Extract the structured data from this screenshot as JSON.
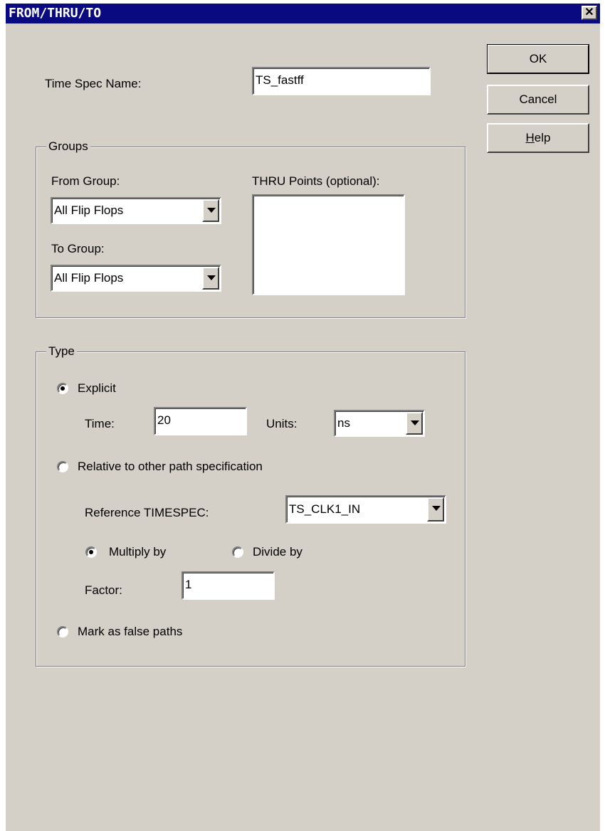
{
  "window": {
    "title": "FROM/THRU/TO",
    "close_glyph": "✕"
  },
  "buttons": {
    "ok": "OK",
    "cancel": "Cancel",
    "help_prefix": "H",
    "help_rest": "elp"
  },
  "timespec": {
    "label": "Time Spec Name:",
    "value": "TS_fastff"
  },
  "groups": {
    "legend": "Groups",
    "from_label": "From Group:",
    "from_value": "All Flip Flops",
    "to_label": "To Group:",
    "to_value": "All Flip Flops",
    "thru_label": "THRU Points (optional):"
  },
  "type": {
    "legend": "Type",
    "explicit_label": "Explicit",
    "explicit_selected": true,
    "time_label": "Time:",
    "time_value": "20",
    "units_label": "Units:",
    "units_value": "ns",
    "relative_label": "Relative to other path specification",
    "reference_label": "Reference TIMESPEC:",
    "reference_value": "TS_CLK1_IN",
    "multiply_label": "Multiply by",
    "divide_label": "Divide by",
    "factor_label": "Factor:",
    "factor_value": "1",
    "false_paths_label": "Mark as false paths"
  },
  "icons": {
    "close": "close-icon",
    "dropdown": "chevron-down-icon"
  }
}
